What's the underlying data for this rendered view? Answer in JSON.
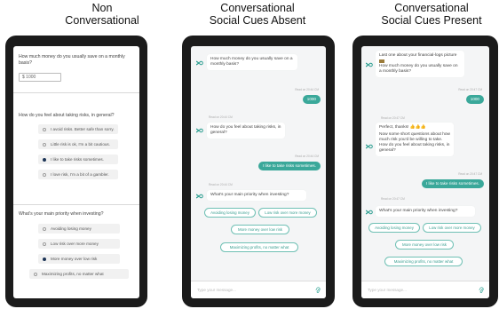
{
  "headings": {
    "h1": {
      "line1": "Non",
      "line2": "Conversational"
    },
    "h2": {
      "line1": "Conversational",
      "line2": "Social Cues Absent"
    },
    "h3": {
      "line1": "Conversational",
      "line2": "Social Cues Present"
    }
  },
  "phone1": {
    "q1": "How much money do you usually save on a monthly basis?",
    "q1_value": "$ 1000",
    "q2": "How do you feel about taking risks, in general?",
    "q2_options": [
      "I avoid risks. Better safe than sorry.",
      "Little risk is ok, I'm a bit cautious.",
      "I like to take risks sometimes.",
      "I love risk, I'm a bit of a gambler."
    ],
    "q2_selected": 2,
    "q3": "What's your main priority when investing?",
    "q3_options": [
      "Avoiding losing money",
      "Low risk over more money",
      "More money over low risk",
      "Maximizing profits, no matter what"
    ],
    "q3_selected": 2
  },
  "phone2": {
    "bot_msg1": "How much money do you usually save on a monthly basis?",
    "ts1": "Read on 20:44 CM",
    "user_reply1": "1000",
    "ts2": "Read on 20:44 CM",
    "bot_msg2": "How do you feel about taking risks, in general?",
    "ts3": "Read on 20:44 CM",
    "user_reply2": "I like to take risks sometimes.",
    "ts4": "Read on 20:44 CM",
    "bot_msg3": "What's your main priority when investing?",
    "chips": [
      "Avoiding losing money",
      "Low risk over more money",
      "More money over low risk",
      "Maximizing profits, no matter what"
    ],
    "composer_placeholder": "Type your message..."
  },
  "phone3": {
    "bot_msg1_line1": "Last one about your financial-logs picture",
    "bot_msg1_line2": "How much money do you usually save on a monthly basis?",
    "ts1": "Read on 20:47 CM",
    "user_reply1": "1000",
    "ts2": "Read on 20:47 CM",
    "bot_msg2_line1": "Perfect, thanks! 👍👍👍",
    "bot_msg2_line2": "Now some short questions about how much risk you'd be willing to take. How do you feel about taking risks, in general?",
    "ts3": "Read on 20:47 CM",
    "user_reply2": "I like to take risks sometimes.",
    "ts4": "Read on 20:47 CM",
    "bot_msg3": "What's your main priority when investing?",
    "chips": [
      "Avoiding losing money",
      "Low risk over more money",
      "More money over low risk",
      "Maximizing profits, no matter what"
    ],
    "composer_placeholder": "Type your message..."
  },
  "colors": {
    "accent": "#3aa89a",
    "chip_border": "#6fc0b4",
    "radio_selected": "#1d3557",
    "phone_frame": "#1b1b1b"
  },
  "icons": {
    "bot": "bot-logo-icon",
    "attach": "paperclip-icon"
  }
}
